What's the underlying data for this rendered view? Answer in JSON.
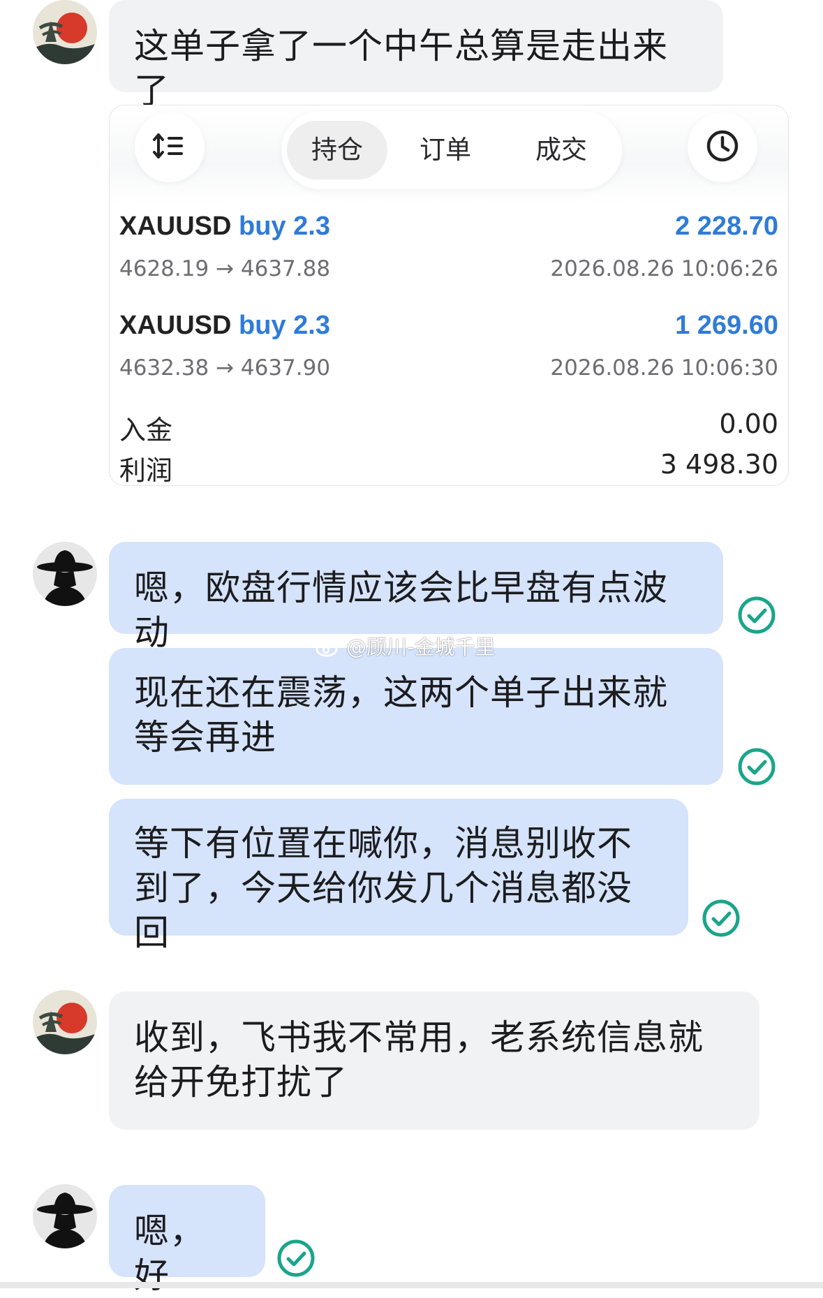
{
  "messages": [
    {
      "sender": "other",
      "text": "这单子拿了一个中午总算是走出来了"
    },
    {
      "sender": "self",
      "text": "嗯，欧盘行情应该会比早盘有点波动",
      "status": "read"
    },
    {
      "sender": "self",
      "text": "现在还在震荡，这两个单子出来就等会再进",
      "status": "read"
    },
    {
      "sender": "self",
      "text": "等下有位置在喊你，消息别收不到了，今天给你发几个消息都没回",
      "status": "read"
    },
    {
      "sender": "other",
      "text": "收到，飞书我不常用，老系统信息就给开免打扰了"
    },
    {
      "sender": "self",
      "text": "嗯，好",
      "status": "read"
    }
  ],
  "trade_card": {
    "tabs": [
      {
        "label": "持仓",
        "active": true
      },
      {
        "label": "订单",
        "active": false
      },
      {
        "label": "成交",
        "active": false
      }
    ],
    "left_icon": "sort-icon",
    "right_icon": "clock-icon",
    "positions": [
      {
        "symbol": "XAUUSD",
        "action": "buy 2.3",
        "prices": "4628.19 → 4637.88",
        "profit": "2 228.70",
        "time": "2026.08.26 10:06:26"
      },
      {
        "symbol": "XAUUSD",
        "action": "buy 2.3",
        "prices": "4632.38 → 4637.90",
        "profit": "1 269.60",
        "time": "2026.08.26 10:06:30"
      }
    ],
    "summary": [
      {
        "label": "入金",
        "value": "0.00"
      },
      {
        "label": "利润",
        "value": "3 498.30"
      }
    ]
  },
  "watermark": "@顾川-金城千里",
  "colors": {
    "self_bubble": "#d5e3fb",
    "other_bubble": "#f1f2f4",
    "read_check": "#1aa58a",
    "accent_blue": "#2f7bd8"
  }
}
